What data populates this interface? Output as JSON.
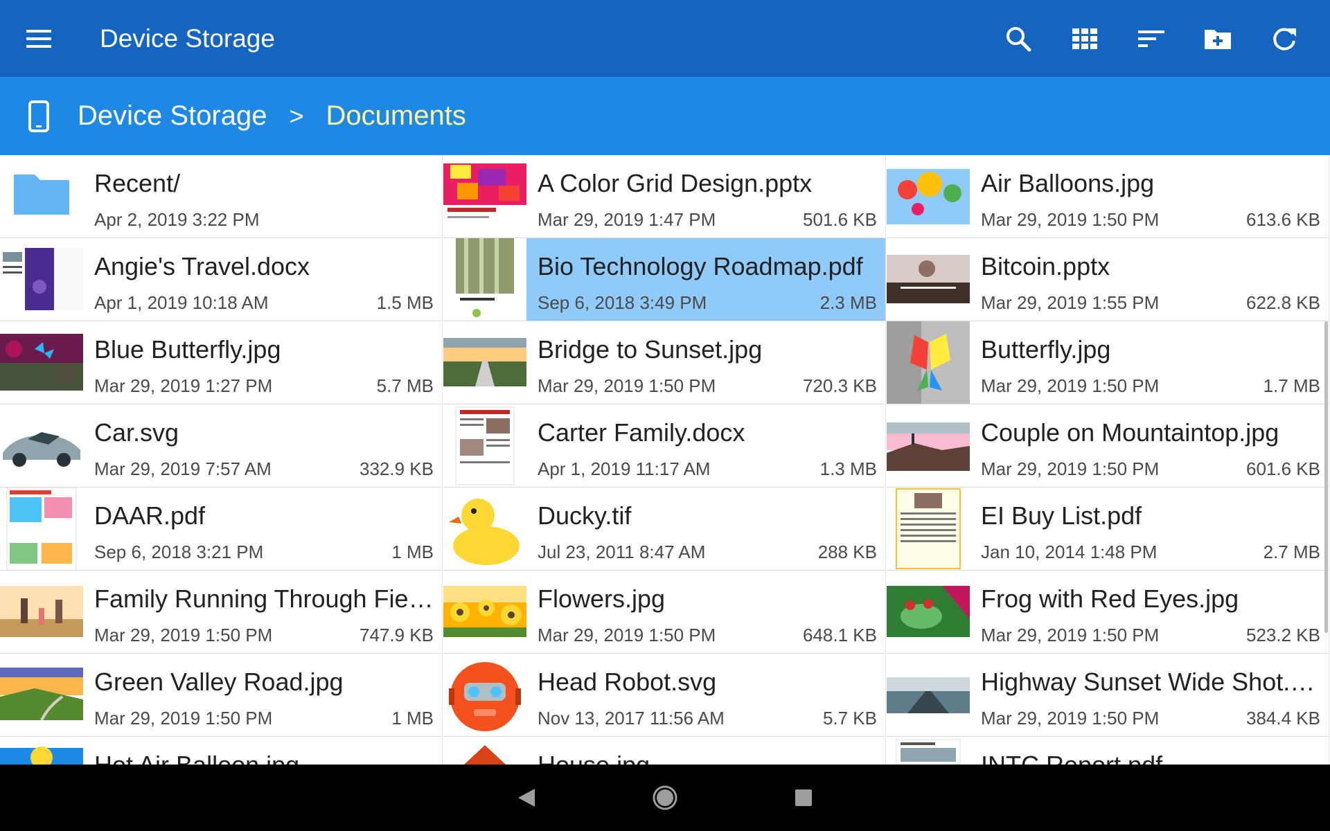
{
  "appbar": {
    "title": "Device Storage",
    "icons": [
      "menu-icon",
      "search-icon",
      "grid-view-icon",
      "sort-icon",
      "new-folder-icon",
      "refresh-icon"
    ],
    "color": "#1565c0"
  },
  "breadcrumb": {
    "root": "Device Storage",
    "separator": ">",
    "current": "Documents",
    "color": "#1e88e5",
    "current_color": "#fff59d"
  },
  "files": [
    {
      "name": "Recent/",
      "date": "Apr 2, 2019 3:22 PM",
      "size": "",
      "thumb": "folder-icon"
    },
    {
      "name": "A Color Grid Design.pptx",
      "date": "Mar 29, 2019 1:47 PM",
      "size": "501.6 KB",
      "thumb": "color-grid-thumbnail"
    },
    {
      "name": "Air Balloons.jpg",
      "date": "Mar 29, 2019 1:50 PM",
      "size": "613.6 KB",
      "thumb": "air-balloons-thumbnail"
    },
    {
      "name": "Angie's Travel.docx",
      "date": "Apr 1, 2019 10:18 AM",
      "size": "1.5 MB",
      "thumb": "travel-doc-thumbnail"
    },
    {
      "name": "Bio Technology Roadmap.pdf",
      "date": "Sep 6, 2018 3:49 PM",
      "size": "2.3 MB",
      "thumb": "biotech-thumbnail",
      "selected": true
    },
    {
      "name": "Bitcoin.pptx",
      "date": "Mar 29, 2019 1:55 PM",
      "size": "622.8 KB",
      "thumb": "bitcoin-thumbnail"
    },
    {
      "name": "Blue Butterfly.jpg",
      "date": "Mar 29, 2019 1:27 PM",
      "size": "5.7 MB",
      "thumb": "blue-butterfly-thumbnail"
    },
    {
      "name": "Bridge to Sunset.jpg",
      "date": "Mar 29, 2019 1:50 PM",
      "size": "720.3 KB",
      "thumb": "bridge-sunset-thumbnail"
    },
    {
      "name": "Butterfly.jpg",
      "date": "Mar 29, 2019 1:50 PM",
      "size": "1.7 MB",
      "thumb": "rainbow-butterfly-thumbnail"
    },
    {
      "name": "Car.svg",
      "date": "Mar 29, 2019 7:57 AM",
      "size": "332.9 KB",
      "thumb": "car-thumbnail"
    },
    {
      "name": "Carter Family.docx",
      "date": "Apr 1, 2019 11:17 AM",
      "size": "1.3 MB",
      "thumb": "carter-doc-thumbnail"
    },
    {
      "name": "Couple on Mountaintop.jpg",
      "date": "Mar 29, 2019 1:50 PM",
      "size": "601.6 KB",
      "thumb": "mountaintop-thumbnail"
    },
    {
      "name": "DAAR.pdf",
      "date": "Sep 6, 2018 3:21 PM",
      "size": "1 MB",
      "thumb": "daar-thumbnail"
    },
    {
      "name": "Ducky.tif",
      "date": "Jul 23, 2011 8:47 AM",
      "size": "288 KB",
      "thumb": "ducky-thumbnail"
    },
    {
      "name": "EI Buy List.pdf",
      "date": "Jan 10, 2014 1:48 PM",
      "size": "2.7 MB",
      "thumb": "buy-list-thumbnail"
    },
    {
      "name": "Family Running Through Fiel…",
      "date": "Mar 29, 2019 1:50 PM",
      "size": "747.9 KB",
      "thumb": "family-running-thumbnail"
    },
    {
      "name": "Flowers.jpg",
      "date": "Mar 29, 2019 1:50 PM",
      "size": "648.1 KB",
      "thumb": "flowers-thumbnail"
    },
    {
      "name": "Frog with Red Eyes.jpg",
      "date": "Mar 29, 2019 1:50 PM",
      "size": "523.2 KB",
      "thumb": "frog-thumbnail"
    },
    {
      "name": "Green Valley Road.jpg",
      "date": "Mar 29, 2019 1:50 PM",
      "size": "1 MB",
      "thumb": "green-valley-thumbnail"
    },
    {
      "name": "Head Robot.svg",
      "date": "Nov 13, 2017 11:56 AM",
      "size": "5.7 KB",
      "thumb": "robot-thumbnail"
    },
    {
      "name": "Highway Sunset Wide Shot.jpg",
      "date": "Mar 29, 2019 1:50 PM",
      "size": "384.4 KB",
      "thumb": "highway-thumbnail"
    },
    {
      "name": "Hot Air Balloon.jpg",
      "date": "",
      "size": "",
      "thumb": "hot-air-balloon-thumbnail"
    },
    {
      "name": "House.jpg",
      "date": "",
      "size": "",
      "thumb": "house-thumbnail"
    },
    {
      "name": "INTC Report.pdf",
      "date": "",
      "size": "",
      "thumb": "intc-report-thumbnail"
    }
  ],
  "navbar": {
    "icons": [
      "back-icon",
      "home-icon",
      "recents-icon"
    ]
  }
}
